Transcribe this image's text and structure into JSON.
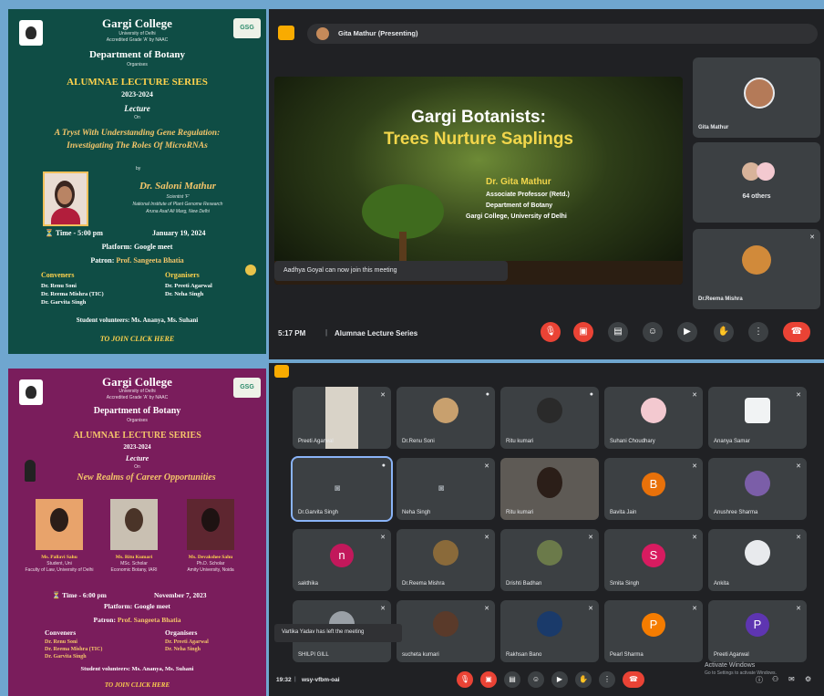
{
  "poster1": {
    "college": "Gargi College",
    "university": "University of Delhi",
    "accreditation": "Accredited Grade 'A' by NAAC",
    "logo_right": "GSG",
    "department": "Department of Botany",
    "organises": "Organises",
    "series": "ALUMNAE LECTURE SERIES",
    "year": "2023-2024",
    "lecture": "Lecture",
    "on": "On",
    "topic_line1": "A Tryst With Understanding Gene Regulation:",
    "topic_line2": "Investigating The Roles Of MicroRNAs",
    "by": "by",
    "speaker": "Dr. Saloni Mathur",
    "speaker_role": "Scientist 'F'",
    "speaker_inst1": "National Institute of Plant Genome Research",
    "speaker_inst2": "Aruna Asaf Ali Marg, New Delhi",
    "time": "Time - 5:00 pm",
    "date": "January 19, 2024",
    "platform": "Platform: Google meet",
    "patron_label": "Patron:",
    "patron_name": "Prof. Sangeeta Bhatia",
    "conveners_label": "Conveners",
    "organisers_label": "Organisers",
    "conveners": [
      "Dr. Renu Soni",
      "Dr. Reema Mishra (TIC)",
      "Dr. Garvita Singh"
    ],
    "organisers": [
      "Dr. Preeti Agarwal",
      "Dr. Neha Singh"
    ],
    "volunteers": "Student volunteers: Ms. Ananya, Ms. Suhani",
    "join": "TO JOIN CLICK HERE"
  },
  "poster2": {
    "college": "Gargi College",
    "university": "University of Delhi",
    "accreditation": "Accredited Grade 'A' by NAAC",
    "logo_right": "GSG",
    "department": "Department of Botany",
    "organises": "Organises",
    "series": "ALUMNAE LECTURE SERIES",
    "year": "2023-2024",
    "lecture": "Lecture",
    "on": "On",
    "topic": "New Realms of Career Opportunities",
    "speakers": [
      {
        "name": "Ms. Pallavi Sahu",
        "role": "Student, Uni",
        "inst": "Faculty of Law, University of Delhi"
      },
      {
        "name": "Ms. Ritu Kumari",
        "role": "MSc. Scholar",
        "inst": "Economic Botany, IARI"
      },
      {
        "name": "Ms. Devakshee Sahu",
        "role": "Ph.D. Scholar",
        "inst": "Amity University, Noida"
      }
    ],
    "time": "Time - 6:00 pm",
    "date": "November 7, 2023",
    "platform": "Platform: Google meet",
    "patron_label": "Patron:",
    "patron_name": "Prof. Sangeeta Bhatia",
    "conveners_label": "Conveners",
    "organisers_label": "Organisers",
    "conveners": [
      "Dr. Renu Soni",
      "Dr. Reema Mishra (TIC)",
      "Dr. Garvita Singh"
    ],
    "organisers": [
      "Dr. Preeti Agarwal",
      "Dr. Neha Singh"
    ],
    "volunteers": "Student volunteers: Ms. Ananya, Ms. Suhani",
    "join": "TO JOIN CLICK HERE"
  },
  "meet1": {
    "presenting": "Gita Mathur (Presenting)",
    "slide_title1": "Gargi Botanists:",
    "slide_title2": "Trees Nurture Saplings",
    "slide_name": "Dr. Gita Mathur",
    "slide_role": "Associate Professor (Retd.)",
    "slide_dept": "Department of Botany",
    "slide_college": "Gargi College, University of Delhi",
    "toast": "Aadhya Goyal can now join this meeting",
    "tiles": [
      "Gita Mathur",
      "64 others",
      "Dr.Reema Mishra"
    ],
    "clock": "5:17 PM",
    "separator": "|",
    "meeting_name": "Alumnae Lecture Series"
  },
  "meet2": {
    "tiles": [
      "Preeti Agarwal",
      "Dr.Renu Soni",
      "Ritu kumari",
      "Suhani Choudhary",
      "Ananya Samar",
      "Dr.Garvita Singh",
      "Neha Singh",
      "Ritu kumari",
      "Bavita Jain",
      "Anushree Sharma",
      "sakthika",
      "Dr.Reema Mishra",
      "Drishti Badhan",
      "Smita Singh",
      "Ankita",
      "SHILPI GILL",
      "sucheta kumari",
      "Rakhsan Bano",
      "Pearl Sharma",
      "Preeti Agarwal"
    ],
    "letters": {
      "b": "B",
      "n": "n",
      "s": "S",
      "p1": "P",
      "p2": "P"
    },
    "toast": "Vartika Yadav has left the meeting",
    "clock": "19:32",
    "separator": "|",
    "meeting_code": "wsy-vfbm-oai",
    "watermark1": "Activate Windows",
    "watermark2": "Go to Settings to activate Windows."
  },
  "colors": {
    "poster1_bg": "#0f4d45",
    "poster2_bg": "#7a1d5c",
    "meet_bg": "#202124",
    "tile_bg": "#3c4043",
    "end_call": "#ea4335",
    "active_border": "#8ab4f8"
  },
  "icons": [
    "college-logo",
    "mic-icon",
    "camera-icon",
    "captions-icon",
    "emoji-icon",
    "present-icon",
    "hand-icon",
    "more-icon",
    "end-call-icon"
  ]
}
